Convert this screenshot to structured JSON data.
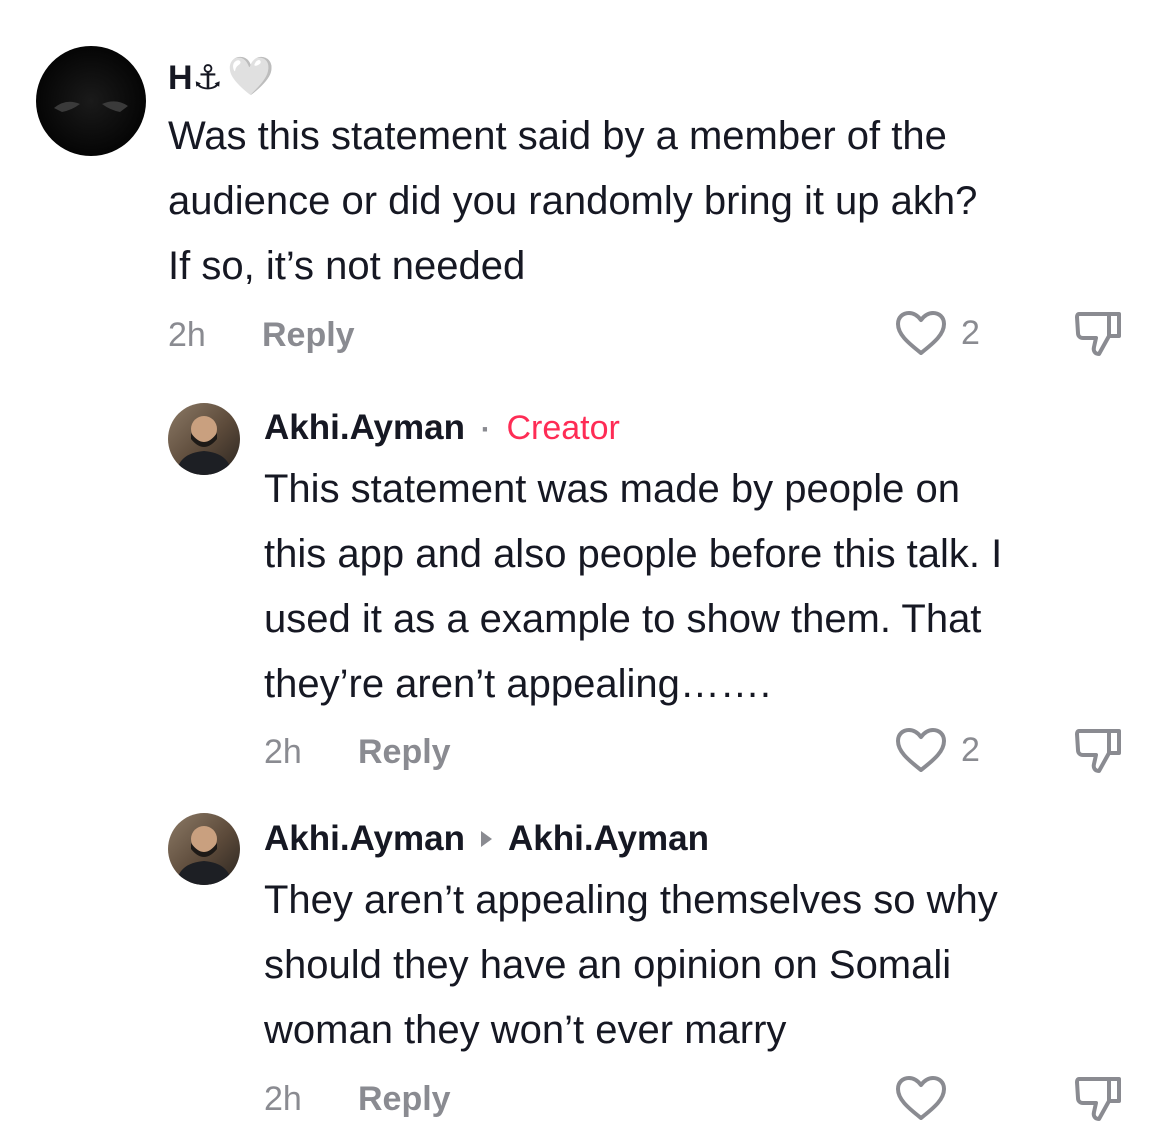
{
  "comments": [
    {
      "username": "H⚓",
      "heart_emoji": "🤍",
      "text_lines": [
        "Was this statement said by a member of the",
        "audience or did you randomly bring it up akh?",
        "If so, it’s not needed"
      ],
      "time": "2h",
      "reply_label": "Reply",
      "likes": "2"
    },
    {
      "username": "Akhi.Ayman",
      "separator": "·",
      "badge": "Creator",
      "text_lines": [
        "This statement was made by people on",
        "this app and also people before this talk. I",
        "used it as a example to show them. That",
        "they’re aren’t appealing……."
      ],
      "time": "2h",
      "reply_label": "Reply",
      "likes": "2"
    },
    {
      "username": "Akhi.Ayman",
      "reply_to": "Akhi.Ayman",
      "text_lines": [
        "They aren’t appealing themselves so why",
        "should they have an opinion on Somali",
        "woman they won’t ever marry"
      ],
      "time": "2h",
      "reply_label": "Reply",
      "likes": ""
    }
  ],
  "icons": {
    "like": "heart-outline-icon",
    "dislike": "thumbs-down-icon",
    "reply_arrow": "caret-right-icon"
  },
  "colors": {
    "text": "#161823",
    "muted": "#8a8b91",
    "creator": "#fe2c55"
  }
}
